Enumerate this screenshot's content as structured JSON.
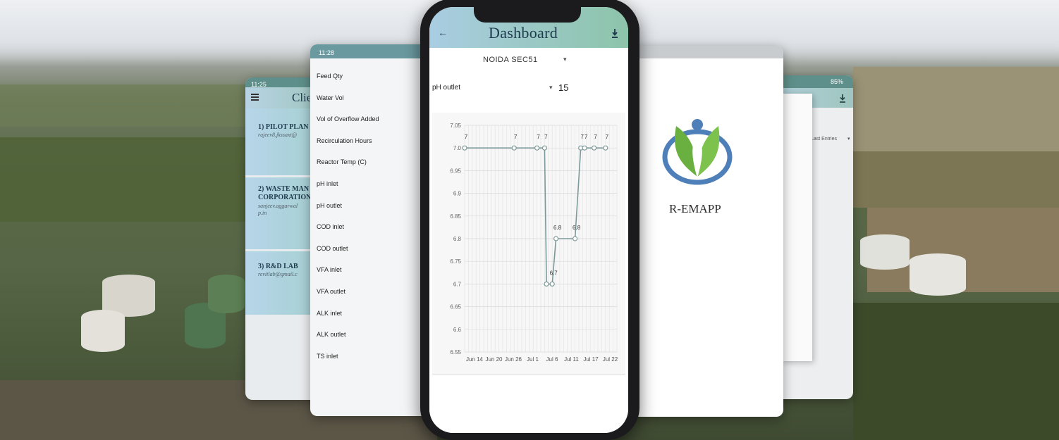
{
  "client_screen": {
    "time": "11:25",
    "title": "Clie",
    "items": [
      {
        "name": "1) PILOT PLAN",
        "email": "rajeev8.jkssaxt@"
      },
      {
        "name": "2) WASTE MAN",
        "name2": "CORPORATION",
        "email": "sanjeev.aggarwal",
        "email2": "p.in"
      },
      {
        "name": "3) R&D LAB",
        "email": "revitlab@gmail.c"
      }
    ]
  },
  "params_screen": {
    "time": "11:28",
    "items": [
      "Feed Qty",
      "Water Vol",
      "Vol of Overflow Added",
      "Recirculation Hours",
      "Reactor Temp (C)",
      "pH inlet",
      "pH outlet",
      "COD inlet",
      "COD outlet",
      "VFA inlet",
      "VFA outlet",
      "ALK inlet",
      "ALK outlet",
      "TS inlet"
    ]
  },
  "dashboard": {
    "title": "Dashboard",
    "site": "NOIDA SEC51",
    "parameter": "pH outlet",
    "entries": "15"
  },
  "splash_screen": {
    "app_name": "R-EMAPP"
  },
  "entries_screen": {
    "battery": "85%",
    "filter": "Last Entries"
  },
  "chart_data": {
    "type": "line",
    "x_ticks": [
      "Jun 14",
      "Jun 20",
      "Jun 26",
      "Jul 1",
      "Jul 6",
      "Jul 11",
      "Jul 17",
      "Jul 22"
    ],
    "y_ticks": [
      "7.05",
      "7.0",
      "6.95",
      "6.9",
      "6.85",
      "6.8",
      "6.75",
      "6.7",
      "6.65",
      "6.6",
      "6.55"
    ],
    "ylim": [
      6.55,
      7.05
    ],
    "xlim": [
      0,
      40
    ],
    "points": [
      {
        "x": 0,
        "y": 7.0,
        "label": "7"
      },
      {
        "x": 13,
        "y": 7.0,
        "label": "7"
      },
      {
        "x": 19,
        "y": 7.0,
        "label": "7"
      },
      {
        "x": 21,
        "y": 7.0,
        "label": "7"
      },
      {
        "x": 21.5,
        "y": 6.7,
        "label": ""
      },
      {
        "x": 23,
        "y": 6.7,
        "label": "6.7"
      },
      {
        "x": 24,
        "y": 6.8,
        "label": "6.8"
      },
      {
        "x": 29,
        "y": 6.8,
        "label": "6.8"
      },
      {
        "x": 30.5,
        "y": 7.0,
        "label": "7"
      },
      {
        "x": 31.5,
        "y": 7.0,
        "label": "7"
      },
      {
        "x": 34,
        "y": 7.0,
        "label": "7"
      },
      {
        "x": 37,
        "y": 7.0,
        "label": "7"
      }
    ]
  }
}
